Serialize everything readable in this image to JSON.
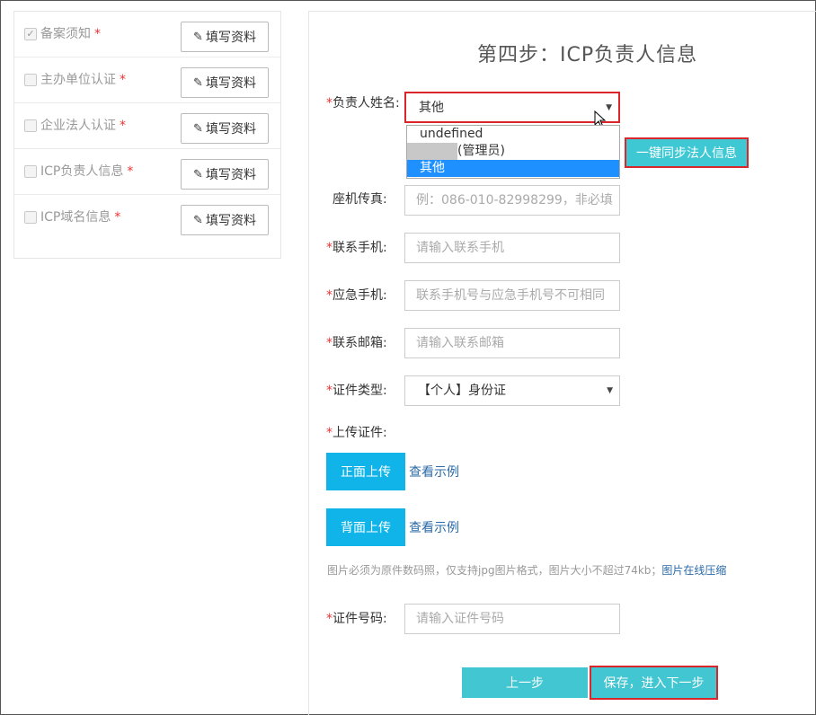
{
  "sidebar": {
    "steps": [
      {
        "label": "备案须知",
        "required": "*",
        "checked": true,
        "button": "填写资料"
      },
      {
        "label": "主办单位认证",
        "required": "*",
        "checked": false,
        "button": "填写资料"
      },
      {
        "label": "企业法人认证",
        "required": "*",
        "checked": false,
        "button": "填写资料"
      },
      {
        "label": "ICP负责人信息",
        "required": "*",
        "checked": false,
        "button": "填写资料"
      },
      {
        "label": "ICP域名信息",
        "required": "*",
        "checked": false,
        "button": "填写资料"
      }
    ]
  },
  "main": {
    "title": "第四步：ICP负责人信息",
    "required_mark": "*",
    "name_field": {
      "label": "负责人姓名:",
      "selected": "其他",
      "options": [
        "undefined",
        "(管理员)",
        "其他"
      ]
    },
    "sync_button": "一键同步法人信息",
    "fax": {
      "label": "座机传真:",
      "placeholder": "例：086-010-82998299，非必填"
    },
    "mobile": {
      "label": "联系手机:",
      "placeholder": "请输入联系手机"
    },
    "emergency": {
      "label": "应急手机:",
      "placeholder": "联系手机号与应急手机号不可相同"
    },
    "email": {
      "label": "联系邮箱:",
      "placeholder": "请输入联系邮箱"
    },
    "id_type": {
      "label": "证件类型:",
      "selected": "【个人】身份证"
    },
    "upload": {
      "label": "上传证件:",
      "front_button": "正面上传",
      "back_button": "背面上传",
      "example_link": "查看示例",
      "hint": "图片必须为原件数码照，仅支持jpg图片格式，图片大小不超过74kb；",
      "hint_link": "图片在线压缩"
    },
    "id_number": {
      "label": "证件号码:",
      "placeholder": "请输入证件号码"
    },
    "prev_button": "上一步",
    "next_button": "保存，进入下一步"
  },
  "colors": {
    "accent": "#42c6d2",
    "upload_blue": "#10b4e8",
    "highlight_red": "#d9262b",
    "link": "#2a6aa8",
    "dropdown_selected": "#1e90ff"
  }
}
